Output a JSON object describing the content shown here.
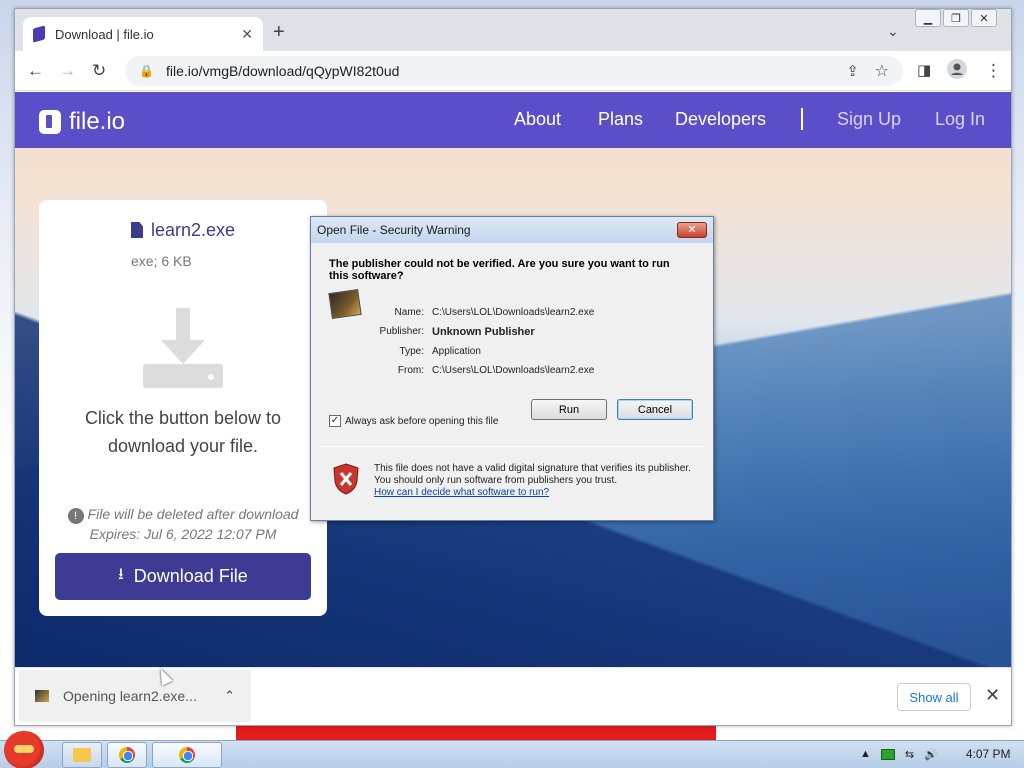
{
  "browser": {
    "tab_title": "Download | file.io",
    "url": "file.io/vmgB/download/qQypWI82t0ud",
    "new_tab_symbol": "+",
    "tab_close_symbol": "✕"
  },
  "window_controls": {
    "minimize": "▁",
    "restore": "❐",
    "close": "✕"
  },
  "site": {
    "logo": "file.io",
    "nav": [
      "About",
      "Plans",
      "Developers"
    ],
    "sign_up": "Sign Up",
    "log_in": "Log In"
  },
  "card": {
    "file_name": "learn2.exe",
    "file_meta": "exe; 6 KB",
    "message": "Click the button below to download your file.",
    "warning_line1": "File will be deleted after download",
    "warning_line2": "Expires: Jul 6, 2022 12:07 PM",
    "download_label": "Download File"
  },
  "dialog": {
    "title": "Open File - Security Warning",
    "question": "The publisher could not be verified.  Are you sure you want to run this software?",
    "fields": [
      {
        "key": "Name:",
        "value": "C:\\Users\\LOL\\Downloads\\learn2.exe"
      },
      {
        "key": "Publisher:",
        "value": "Unknown Publisher"
      },
      {
        "key": "Type:",
        "value": "Application"
      },
      {
        "key": "From:",
        "value": "C:\\Users\\LOL\\Downloads\\learn2.exe"
      }
    ],
    "run_label": "Run",
    "cancel_label": "Cancel",
    "checkbox_label": "Always ask before opening this file",
    "checkbox_checked": true,
    "info_text": "This file does not have a valid digital signature that verifies its publisher.  You should only run software from publishers you trust.",
    "info_link": "How can I decide what software to run?"
  },
  "download_bar": {
    "item_text": "Opening learn2.exe...",
    "show_all": "Show all"
  },
  "taskbar": {
    "clock": "4:07 PM"
  },
  "colors": {
    "brand": "#5a4fc9",
    "button": "#3d3b94"
  }
}
